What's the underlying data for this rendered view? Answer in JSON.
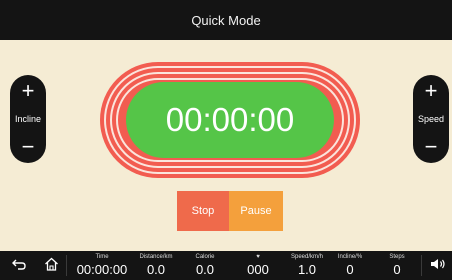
{
  "header": {
    "title": "Quick Mode"
  },
  "incline": {
    "plus": "+",
    "label": "Incline",
    "minus": "−"
  },
  "speed": {
    "plus": "+",
    "label": "Speed",
    "minus": "−"
  },
  "timer": {
    "display": "00:00:00"
  },
  "controls": {
    "stop": "Stop",
    "pause": "Pause"
  },
  "bottom": {
    "back_icon": "back-arrow-icon",
    "home_icon": "home-icon",
    "volume_icon": "volume-icon",
    "metrics": [
      {
        "label": "Time",
        "value": "00:00:00"
      },
      {
        "label": "Distance/km",
        "value": "0.0"
      },
      {
        "label": "Calorie",
        "value": "0.0"
      },
      {
        "label": "♥",
        "value": "000"
      },
      {
        "label": "Speed/km/h",
        "value": "1.0"
      },
      {
        "label": "Incline/%",
        "value": "0"
      },
      {
        "label": "Steps",
        "value": "0"
      }
    ]
  },
  "colors": {
    "background": "#f5ecd4",
    "bar": "#141414",
    "track": "#f25c50",
    "timer_pill": "#55c548",
    "stop": "#ef6a4b",
    "pause": "#f4a03c",
    "heart": "#f04040"
  }
}
